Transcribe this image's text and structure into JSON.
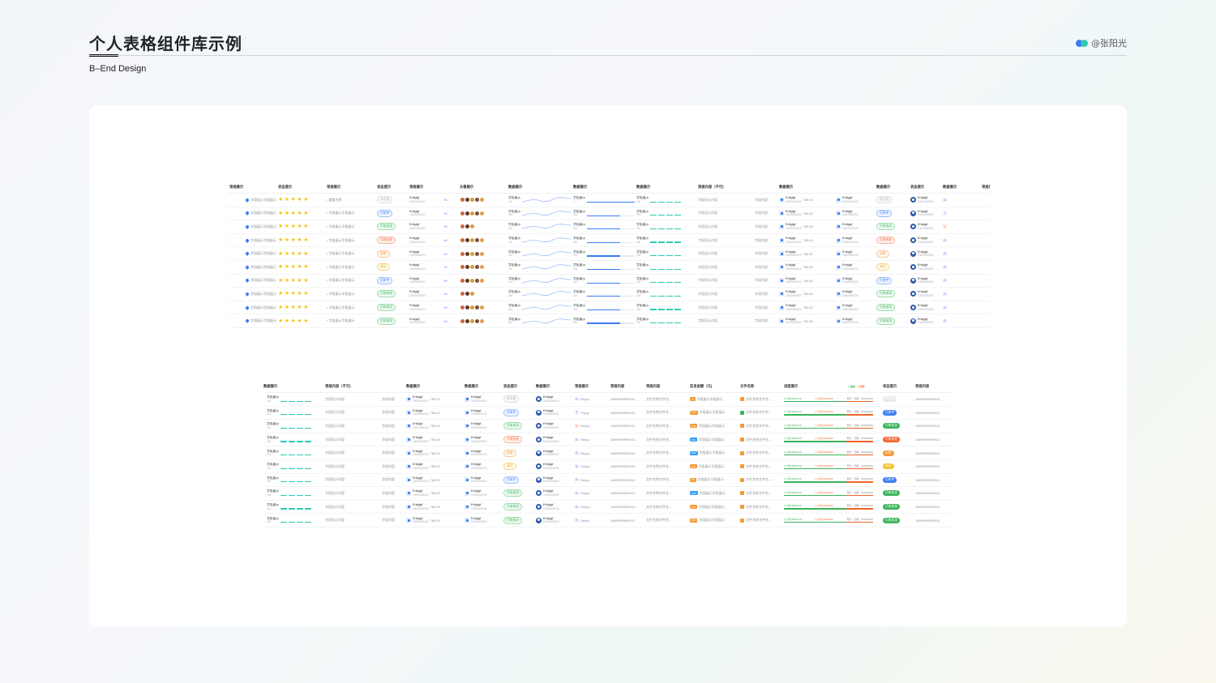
{
  "header": {
    "title": "个人表格组件库示例",
    "subtitle": "B–End Design",
    "author": "@张阳光"
  },
  "colors": {
    "accent_blue": "#3b7cf5",
    "accent_teal": "#2fc9b4",
    "star": "#f5c518",
    "status_green": "#3ab35a",
    "status_red": "#f0642c",
    "status_orange": "#f29a38",
    "status_yellow": "#f5c22f",
    "status_gray": "#cfd3d8"
  },
  "icons": [
    "location-pin-icon",
    "star-icon",
    "avatar-icon",
    "brand-dots-icon",
    "file-icon",
    "user-circle-icon"
  ],
  "table1": {
    "headers": [
      "常规展示",
      "状态提示",
      "常规展示",
      "状态提示",
      "常规展示",
      "",
      "头像展示",
      "数据展示",
      "数据展示",
      "数据展示",
      "常规内容（不可)",
      "",
      "数据展示",
      "",
      "数据展示",
      "状态提示",
      "数据展示",
      "常规展"
    ],
    "rows": [
      {
        "field": "字段展示字段展示",
        "label": "重要名称",
        "status": "状态值",
        "status_color": "gray",
        "name": "Enllgigf",
        "sub": "13000000000",
        "more": "+6",
        "avatars": 5,
        "chart_title": "字段展示",
        "chart_val": "100",
        "mini_val": "1...",
        "content": "字段显示内容",
        "field2": "字段内容",
        "amount": "780.00",
        "tag2": "状态值",
        "tag2_color": "gray",
        "letter": "D",
        "letter_color": "blue"
      },
      {
        "field": "字段展示字段展示",
        "label": "字段展示字段展示",
        "status": "打款中",
        "status_color": "blue",
        "name": "Enllgigf",
        "sub": "13000000000",
        "more": "+6",
        "avatars": 5,
        "chart_title": "字段展示",
        "chart_val": "100",
        "mini_val": "100",
        "content": "字段显示内容",
        "field2": "字段内容",
        "amount": "780.00",
        "tag2": "打款中",
        "tag2_color": "blue",
        "letter": "T",
        "letter_color": "blue"
      },
      {
        "field": "字段展示字段展示",
        "label": "字段展示字段展示",
        "status": "打款成功",
        "status_color": "green",
        "name": "Enllgigf",
        "sub": "13000000000",
        "more": "+6",
        "avatars": 3,
        "chart_title": "字段展示",
        "chart_val": "100",
        "mini_val": "100",
        "content": "字段显示内容",
        "field2": "字段内容",
        "amount": "780.00",
        "tag2": "打款成功",
        "tag2_color": "green",
        "letter": "D",
        "letter_color": "red"
      },
      {
        "field": "字段展示字段展示",
        "label": "字段展示字段展示",
        "status": "打款失败",
        "status_color": "red",
        "name": "Enllgigf",
        "sub": "13000000000",
        "more": "+6",
        "avatars": 5,
        "chart_title": "字段展示",
        "chart_val": "100",
        "mini_val": "100",
        "content": "字段显示内容",
        "field2": "字段内容",
        "amount": "780.00",
        "tag2": "打款失败",
        "tag2_color": "red",
        "letter": "D",
        "letter_color": "blue"
      },
      {
        "field": "字段展示字段展示",
        "label": "字段展示字段展示",
        "status": "异常",
        "status_color": "orange",
        "name": "Enllgigf",
        "sub": "13000000000",
        "more": "+6",
        "avatars": 5,
        "chart_title": "字段展示",
        "chart_val": "100",
        "mini_val": "100",
        "content": "字段显示内容",
        "field2": "字段内容",
        "amount": "780.00",
        "tag2": "异常",
        "tag2_color": "orange",
        "letter": "D",
        "letter_color": "blue"
      },
      {
        "field": "字段展示字段展示",
        "label": "字段展示字段展示",
        "status": "成功",
        "status_color": "yellow",
        "name": "Enllgigf",
        "sub": "13000000000",
        "more": "+6",
        "avatars": 5,
        "chart_title": "字段展示",
        "chart_val": "100",
        "mini_val": "100",
        "content": "字段显示内容",
        "field2": "字段内容",
        "amount": "780.00",
        "tag2": "成功",
        "tag2_color": "yellow",
        "letter": "D",
        "letter_color": "blue"
      },
      {
        "field": "字段展示字段展示",
        "label": "字段展示字段展示",
        "status": "打款中",
        "status_color": "blue",
        "name": "Enllgigf",
        "sub": "13000000000",
        "more": "+6",
        "avatars": 5,
        "chart_title": "字段展示",
        "chart_val": "100",
        "mini_val": "100",
        "content": "字段显示内容",
        "field2": "字段内容",
        "amount": "780.00",
        "tag2": "打款中",
        "tag2_color": "blue",
        "letter": "D",
        "letter_color": "blue"
      },
      {
        "field": "字段展示字段展示",
        "label": "字段展示字段展示",
        "status": "打款成功",
        "status_color": "green",
        "name": "Enllgigf",
        "sub": "13000000000",
        "more": "+6",
        "avatars": 3,
        "chart_title": "字段展示",
        "chart_val": "100",
        "mini_val": "100",
        "content": "字段显示内容",
        "field2": "字段内容",
        "amount": "780.00",
        "tag2": "打款成功",
        "tag2_color": "green",
        "letter": "D",
        "letter_color": "blue"
      },
      {
        "field": "字段展示字段展示",
        "label": "字段展示字段展示",
        "status": "打款成功",
        "status_color": "green",
        "name": "Enllgigf",
        "sub": "13000000000",
        "more": "+6",
        "avatars": 5,
        "chart_title": "字段展示",
        "chart_val": "100",
        "mini_val": "100",
        "content": "字段显示内容",
        "field2": "字段内容",
        "amount": "780.00",
        "tag2": "打款成功",
        "tag2_color": "green",
        "letter": "D",
        "letter_color": "blue"
      },
      {
        "field": "字段展示字段展示",
        "label": "字段展示字段展示",
        "status": "打款成功",
        "status_color": "green",
        "name": "Enllgigf",
        "sub": "13000000000",
        "more": "+6",
        "avatars": 5,
        "chart_title": "字段展示",
        "chart_val": "100",
        "mini_val": "100",
        "content": "字段显示内容",
        "field2": "字段内容",
        "amount": "780.00",
        "tag2": "打款成功",
        "tag2_color": "green",
        "letter": "D",
        "letter_color": "blue"
      }
    ]
  },
  "table2": {
    "headers": [
      "数据展示",
      "常规内容（不可)",
      "",
      "数据展示",
      "数据展示",
      "状态提示",
      "数据展示",
      "常规展示",
      "常规内容",
      "常规内容",
      "实发金额（元)",
      "文件名称",
      "进度展示",
      "状态提示",
      "常规内容"
    ],
    "progress_legend": [
      "● 提成",
      "● 实际"
    ],
    "rows": [
      {
        "chart_title": "字段展示",
        "chart_val": "100",
        "content": "字段显示内容",
        "field2": "字段内容",
        "name": "Enllgigf",
        "sub": "13000000000",
        "amount": "780.00",
        "status": "状态值",
        "status_color": "gray",
        "letter": "D",
        "letter_color": "blue",
        "person": "Drlyuy",
        "phone": "16899999999111",
        "file_text": "文件名称文件名...",
        "ft_label": "JS",
        "ft_color": "o",
        "amt_text": "字段展示字段展示",
        "fname": "文件名称文件名...",
        "fi_color": "o",
        "p1": "● 计划 80000.00",
        "p2": "● 计划 20000.00",
        "p3": "预计 · 日期 · 100000000",
        "tag2": "状态值",
        "tag2_color": "gray",
        "last": "16899999999111"
      },
      {
        "chart_title": "字段展示",
        "chart_val": "100",
        "content": "字段显示内容",
        "field2": "字段内容",
        "name": "Enllgigf",
        "sub": "13000000000",
        "amount": "780.00",
        "status": "打款中",
        "status_color": "blue",
        "letter": "T",
        "letter_color": "blue",
        "person": "Trlyuy",
        "phone": "16899999999111",
        "file_text": "文件名称文件名...",
        "ft_label": "DOC",
        "ft_color": "o",
        "amt_text": "字段展示字段展示",
        "fname": "文件名称文件名...",
        "fi_color": "g",
        "p1": "● 计划 80000.00",
        "p2": "● 计划 20000.00",
        "p3": "预计 · 日期 · 100000000",
        "tag2": "打款中",
        "tag2_color": "blue",
        "last": "16899999999111"
      },
      {
        "chart_title": "字段展示",
        "chart_val": "100",
        "content": "字段显示内容",
        "field2": "字段内容",
        "name": "Enllgigf",
        "sub": "13000000000",
        "amount": "780.00",
        "status": "打款成功",
        "status_color": "green",
        "letter": "D",
        "letter_color": "red",
        "person": "Drlyuy",
        "phone": "16899999999111",
        "file_text": "文件名称文件名...",
        "ft_label": "PDF",
        "ft_color": "o",
        "amt_text": "字段展示字段展示",
        "fname": "文件名称文件名...",
        "fi_color": "o",
        "p1": "● 计划 80000.00",
        "p2": "● 计划 20000.00",
        "p3": "预计 · 日期 · 100000000",
        "tag2": "打款成功",
        "tag2_color": "green",
        "last": "16899999999111"
      },
      {
        "chart_title": "字段展示",
        "chart_val": "100",
        "content": "字段显示内容",
        "field2": "字段内容",
        "name": "Enllgigf",
        "sub": "13000000000",
        "amount": "780.00",
        "status": "打款失败",
        "status_color": "red",
        "letter": "D",
        "letter_color": "blue",
        "person": "Drlyuy",
        "phone": "16899999999111",
        "file_text": "文件名称文件名...",
        "ft_label": "JPG",
        "ft_color": "b",
        "amt_text": "字段展示字段展示",
        "fname": "文件名称文件名...",
        "fi_color": "o",
        "p1": "● 计划 80000.00",
        "p2": "● 计划 20000.00",
        "p3": "预计 · 日期 · 100000000",
        "tag2": "打款失败",
        "tag2_color": "red",
        "last": "16899999999111"
      },
      {
        "chart_title": "字段展示",
        "chart_val": "100",
        "content": "字段显示内容",
        "field2": "字段内容",
        "name": "Enllgigf",
        "sub": "13000000000",
        "amount": "780.00",
        "status": "异常",
        "status_color": "orange",
        "letter": "D",
        "letter_color": "blue",
        "person": "Drlyuy",
        "phone": "16899999999111",
        "file_text": "文件名称文件名...",
        "ft_label": "PNG",
        "ft_color": "b",
        "amt_text": "字段展示字段展示",
        "fname": "文件名称文件名...",
        "fi_color": "o",
        "p1": "● 计划 80000.00",
        "p2": "● 计划 20000.00",
        "p3": "预计 · 日期 · 100000000",
        "tag2": "异常",
        "tag2_color": "orange",
        "last": "16899999999111"
      },
      {
        "chart_title": "字段展示",
        "chart_val": "100",
        "content": "字段显示内容",
        "field2": "字段内容",
        "name": "Enllgigf",
        "sub": "13000000000",
        "amount": "780.00",
        "status": "成功",
        "status_color": "yellow",
        "letter": "D",
        "letter_color": "blue",
        "person": "Drlyuy",
        "phone": "16899999999111",
        "file_text": "文件名称文件名...",
        "ft_label": "XLS",
        "ft_color": "o",
        "amt_text": "字段展示字段展示",
        "fname": "文件名称文件名...",
        "fi_color": "o",
        "p1": "● 计划 80000.00",
        "p2": "● 计划 20000.00",
        "p3": "预计 · 日期 · 100000000",
        "tag2": "成功",
        "tag2_color": "yellow",
        "last": "16899999999111"
      },
      {
        "chart_title": "字段展示",
        "chart_val": "100",
        "content": "字段显示内容",
        "field2": "字段内容",
        "name": "Enllgigf",
        "sub": "13000000000",
        "amount": "780.00",
        "status": "打款中",
        "status_color": "blue",
        "letter": "D",
        "letter_color": "blue",
        "person": "Drlyuy",
        "phone": "16899999999111",
        "file_text": "文件名称文件名...",
        "ft_label": "ZIP",
        "ft_color": "o",
        "amt_text": "字段展示字段展示",
        "fname": "文件名称文件名...",
        "fi_color": "o",
        "p1": "● 计划 80000.00",
        "p2": "● 计划 20000.00",
        "p3": "预计 · 日期 · 100000000",
        "tag2": "打款中",
        "tag2_color": "blue",
        "last": "16899999999111"
      },
      {
        "chart_title": "字段展示",
        "chart_val": "100",
        "content": "字段显示内容",
        "field2": "字段内容",
        "name": "Enllgigf",
        "sub": "13000000000",
        "amount": "780.00",
        "status": "打款成功",
        "status_color": "green",
        "letter": "D",
        "letter_color": "blue",
        "person": "Drlyuy",
        "phone": "16899999999111",
        "file_text": "文件名称文件名...",
        "ft_label": "DWT",
        "ft_color": "b",
        "amt_text": "字段展示字段展示",
        "fname": "文件名称文件名...",
        "fi_color": "o",
        "p1": "● 计划 80000.00",
        "p2": "● 计划 20000.00",
        "p3": "预计 · 日期 · 100000000",
        "tag2": "打款成功",
        "tag2_color": "green",
        "last": "16899999999111"
      },
      {
        "chart_title": "字段展示",
        "chart_val": "100",
        "content": "字段显示内容",
        "field2": "字段内容",
        "name": "Enllgigf",
        "sub": "13000000000",
        "amount": "780.00",
        "status": "打款成功",
        "status_color": "green",
        "letter": "D",
        "letter_color": "blue",
        "person": "Drlyuy",
        "phone": "16899999999111",
        "file_text": "文件名称文件名...",
        "ft_label": "PPT",
        "ft_color": "o",
        "amt_text": "字段展示字段展示",
        "fname": "文件名称文件名...",
        "fi_color": "o",
        "p1": "● 计划 80000.00",
        "p2": "● 计划 20000.00",
        "p3": "预计 · 日期 · 100000000",
        "tag2": "打款成功",
        "tag2_color": "green",
        "last": "16899999999111"
      },
      {
        "chart_title": "字段展示",
        "chart_val": "100",
        "content": "字段显示内容",
        "field2": "字段内容",
        "name": "Enllgigf",
        "sub": "13000000000",
        "amount": "780.00",
        "status": "打款成功",
        "status_color": "green",
        "letter": "D",
        "letter_color": "blue",
        "person": "Drlyuy",
        "phone": "16899999999111",
        "file_text": "文件名称文件名...",
        "ft_label": "MP4",
        "ft_color": "o",
        "amt_text": "字段展示字段展示",
        "fname": "文件名称文件名...",
        "fi_color": "o",
        "p1": "● 计划 80000.00",
        "p2": "● 计划 20000.00",
        "p3": "预计 · 日期 · 100000000",
        "tag2": "打款成功",
        "tag2_color": "green",
        "last": "16899999999111"
      }
    ]
  }
}
